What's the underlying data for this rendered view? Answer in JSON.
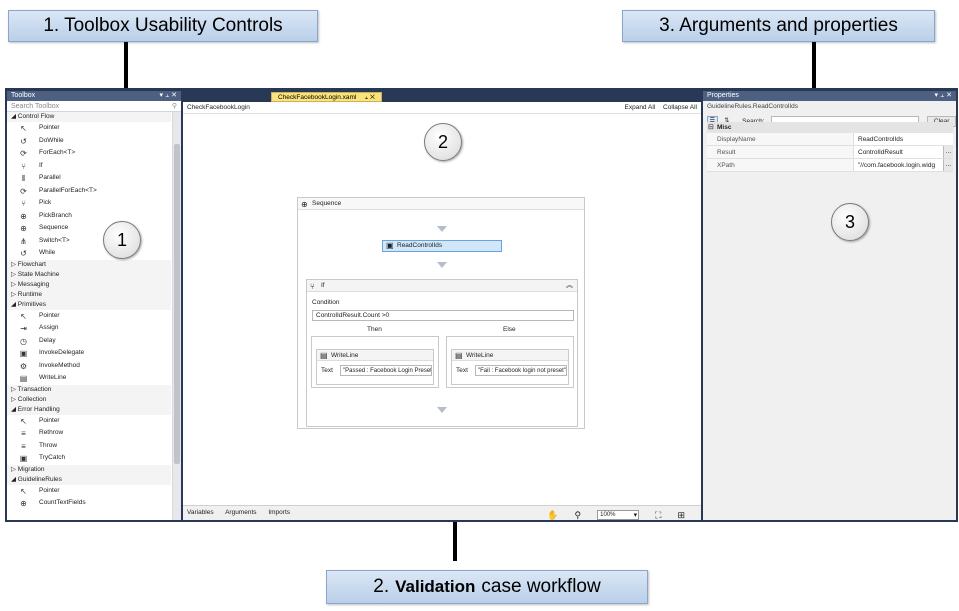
{
  "callouts": {
    "c1": "1. Toolbox Usability Controls",
    "c2_bold": "Validation",
    "c2_prefix": "2.",
    "c2_suffix": "case workflow",
    "c3": "3. Arguments and properties"
  },
  "circles": {
    "one": "1",
    "two": "2",
    "three": "3"
  },
  "toolbox": {
    "title": "Toolbox",
    "header_controls": "▾ ⫠ ✕",
    "search_placeholder": "Search Toolbox",
    "search_icon": "⚲",
    "entries": [
      {
        "kind": "cat",
        "label": "◢ Control Flow"
      },
      {
        "kind": "item",
        "label": "Pointer",
        "icon": "pointer-icon",
        "glyph": "↖"
      },
      {
        "kind": "item",
        "label": "DoWhile",
        "icon": "dowhile-icon",
        "glyph": "↺"
      },
      {
        "kind": "item",
        "label": "ForEach<T>",
        "icon": "foreach-icon",
        "glyph": "⟳"
      },
      {
        "kind": "item",
        "label": "If",
        "icon": "if-icon",
        "glyph": "⑂"
      },
      {
        "kind": "item",
        "label": "Parallel",
        "icon": "parallel-icon",
        "glyph": "⦀"
      },
      {
        "kind": "item",
        "label": "ParallelForEach<T>",
        "icon": "parallelforeach-icon",
        "glyph": "⟳"
      },
      {
        "kind": "item",
        "label": "Pick",
        "icon": "pick-icon",
        "glyph": "⑂"
      },
      {
        "kind": "item",
        "label": "PickBranch",
        "icon": "pickbranch-icon",
        "glyph": "⊕"
      },
      {
        "kind": "item",
        "label": "Sequence",
        "icon": "sequence-icon",
        "glyph": "⊕"
      },
      {
        "kind": "item",
        "label": "Switch<T>",
        "icon": "switch-icon",
        "glyph": "⋔"
      },
      {
        "kind": "item",
        "label": "While",
        "icon": "while-icon",
        "glyph": "↺"
      },
      {
        "kind": "cat",
        "label": "▷ Flowchart"
      },
      {
        "kind": "cat",
        "label": "▷ State Machine"
      },
      {
        "kind": "cat",
        "label": "▷ Messaging"
      },
      {
        "kind": "cat",
        "label": "▷ Runtime"
      },
      {
        "kind": "cat",
        "label": "◢ Primitives"
      },
      {
        "kind": "item",
        "label": "Pointer",
        "icon": "pointer-icon",
        "glyph": "↖"
      },
      {
        "kind": "item",
        "label": "Assign",
        "icon": "assign-icon",
        "glyph": "⇥"
      },
      {
        "kind": "item",
        "label": "Delay",
        "icon": "delay-icon",
        "glyph": "◷"
      },
      {
        "kind": "item",
        "label": "InvokeDelegate",
        "icon": "invokedelegate-icon",
        "glyph": "▣"
      },
      {
        "kind": "item",
        "label": "InvokeMethod",
        "icon": "invokemethod-icon",
        "glyph": "⚙"
      },
      {
        "kind": "item",
        "label": "WriteLine",
        "icon": "writeline-icon",
        "glyph": "▤"
      },
      {
        "kind": "cat",
        "label": "▷ Transaction"
      },
      {
        "kind": "cat",
        "label": "▷ Collection"
      },
      {
        "kind": "cat",
        "label": "◢ Error Handling"
      },
      {
        "kind": "item",
        "label": "Pointer",
        "icon": "pointer-icon",
        "glyph": "↖"
      },
      {
        "kind": "item",
        "label": "Rethrow",
        "icon": "rethrow-icon",
        "glyph": "≡"
      },
      {
        "kind": "item",
        "label": "Throw",
        "icon": "throw-icon",
        "glyph": "≡"
      },
      {
        "kind": "item",
        "label": "TryCatch",
        "icon": "trycatch-icon",
        "glyph": "▣"
      },
      {
        "kind": "cat",
        "label": "▷ Migration"
      },
      {
        "kind": "cat",
        "label": "◢ GuidelineRules"
      },
      {
        "kind": "item",
        "label": "Pointer",
        "icon": "pointer-icon",
        "glyph": "↖"
      },
      {
        "kind": "item",
        "label": "CountTextFields",
        "icon": "counttextfields-icon",
        "glyph": "⊕"
      }
    ]
  },
  "designer": {
    "tab_label": "CheckFacebookLogin.xaml",
    "tab_controls": "⫠ ✕",
    "breadcrumb": "CheckFacebookLogin",
    "expand_all": "Expand All",
    "collapse_all": "Collapse All",
    "sequence_label": "Sequence",
    "read_control_label": "ReadControlIds",
    "if_label": "If",
    "condition_label": "Condition",
    "condition_value": "ControlIdResult.Count >0",
    "then_label": "Then",
    "else_label": "Else",
    "then_writeline": {
      "title": "WriteLine",
      "text_label": "Text",
      "value": "\"Passed : Facebook Login Preset\""
    },
    "else_writeline": {
      "title": "WriteLine",
      "text_label": "Text",
      "value": "\"Fail : Facebook login not preset\""
    },
    "status": {
      "variables": "Variables",
      "arguments": "Arguments",
      "imports": "Imports",
      "zoom": "100%"
    }
  },
  "properties": {
    "title": "Properties",
    "header_controls": "▾ ⫠ ✕",
    "object": "GuidelineRules.ReadControlIds",
    "search_label": "Search:",
    "clear_label": "Clear",
    "category": "Misc",
    "rows": [
      {
        "key": "DisplayName",
        "value": "ReadControlIds"
      },
      {
        "key": "Result",
        "value": "ControlIdResult"
      },
      {
        "key": "XPath",
        "value": "\"//com.facebook.login.widg"
      }
    ]
  },
  "colors": {
    "studio_frame": "#293955",
    "tab_active": "#f9e37a",
    "selected_activity": "#cfe6fb",
    "callout_bg": "#c6d9f0"
  }
}
